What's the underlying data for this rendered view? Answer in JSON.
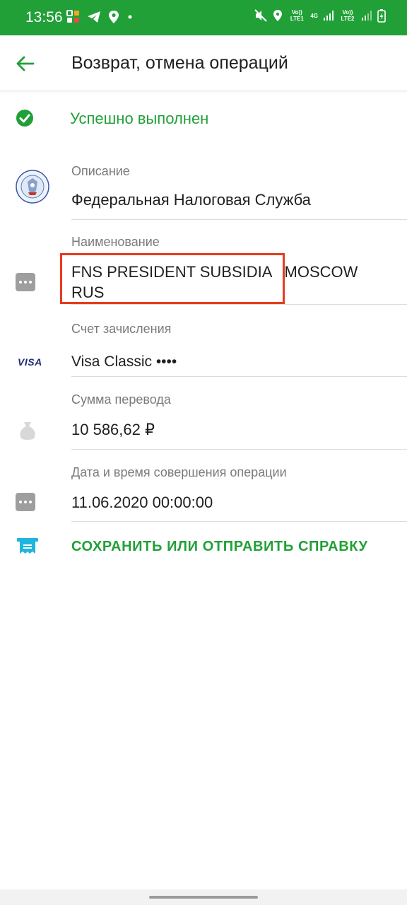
{
  "status_bar": {
    "time": "13:56",
    "net1": "Vo)) LTE1",
    "net_4g": "4G",
    "net2": "Vo)) LTE2"
  },
  "header": {
    "title": "Возврат, отмена операций",
    "back_icon": "arrow-left-icon"
  },
  "status": {
    "text": "Успешно выполнен",
    "icon": "check-circle-icon",
    "color": "#21a038"
  },
  "fields": {
    "description": {
      "label": "Описание",
      "value": "Федеральная Налоговая Служба",
      "icon": "fns-emblem-icon"
    },
    "name": {
      "label": "Наименование",
      "value": "FNS PRESIDENT SUBSIDIA   MOSCOW RUS",
      "icon": "dots-icon"
    },
    "account": {
      "label": "Счет зачисления",
      "value": "Visa Classic ••••",
      "icon": "visa-logo-icon",
      "icon_text": "VISA"
    },
    "amount": {
      "label": "Сумма перевода",
      "value": "10 586,62 ₽",
      "icon": "money-bag-icon"
    },
    "datetime": {
      "label": "Дата и время совершения операции",
      "value": "11.06.2020 00:00:00",
      "icon": "dots-icon"
    }
  },
  "action": {
    "label": "СОХРАНИТЬ ИЛИ ОТПРАВИТЬ СПРАВКУ",
    "icon": "receipt-icon"
  },
  "colors": {
    "brand_green": "#21a038",
    "highlight_red": "#e53c1e",
    "receipt_blue": "#1fb5e0"
  }
}
